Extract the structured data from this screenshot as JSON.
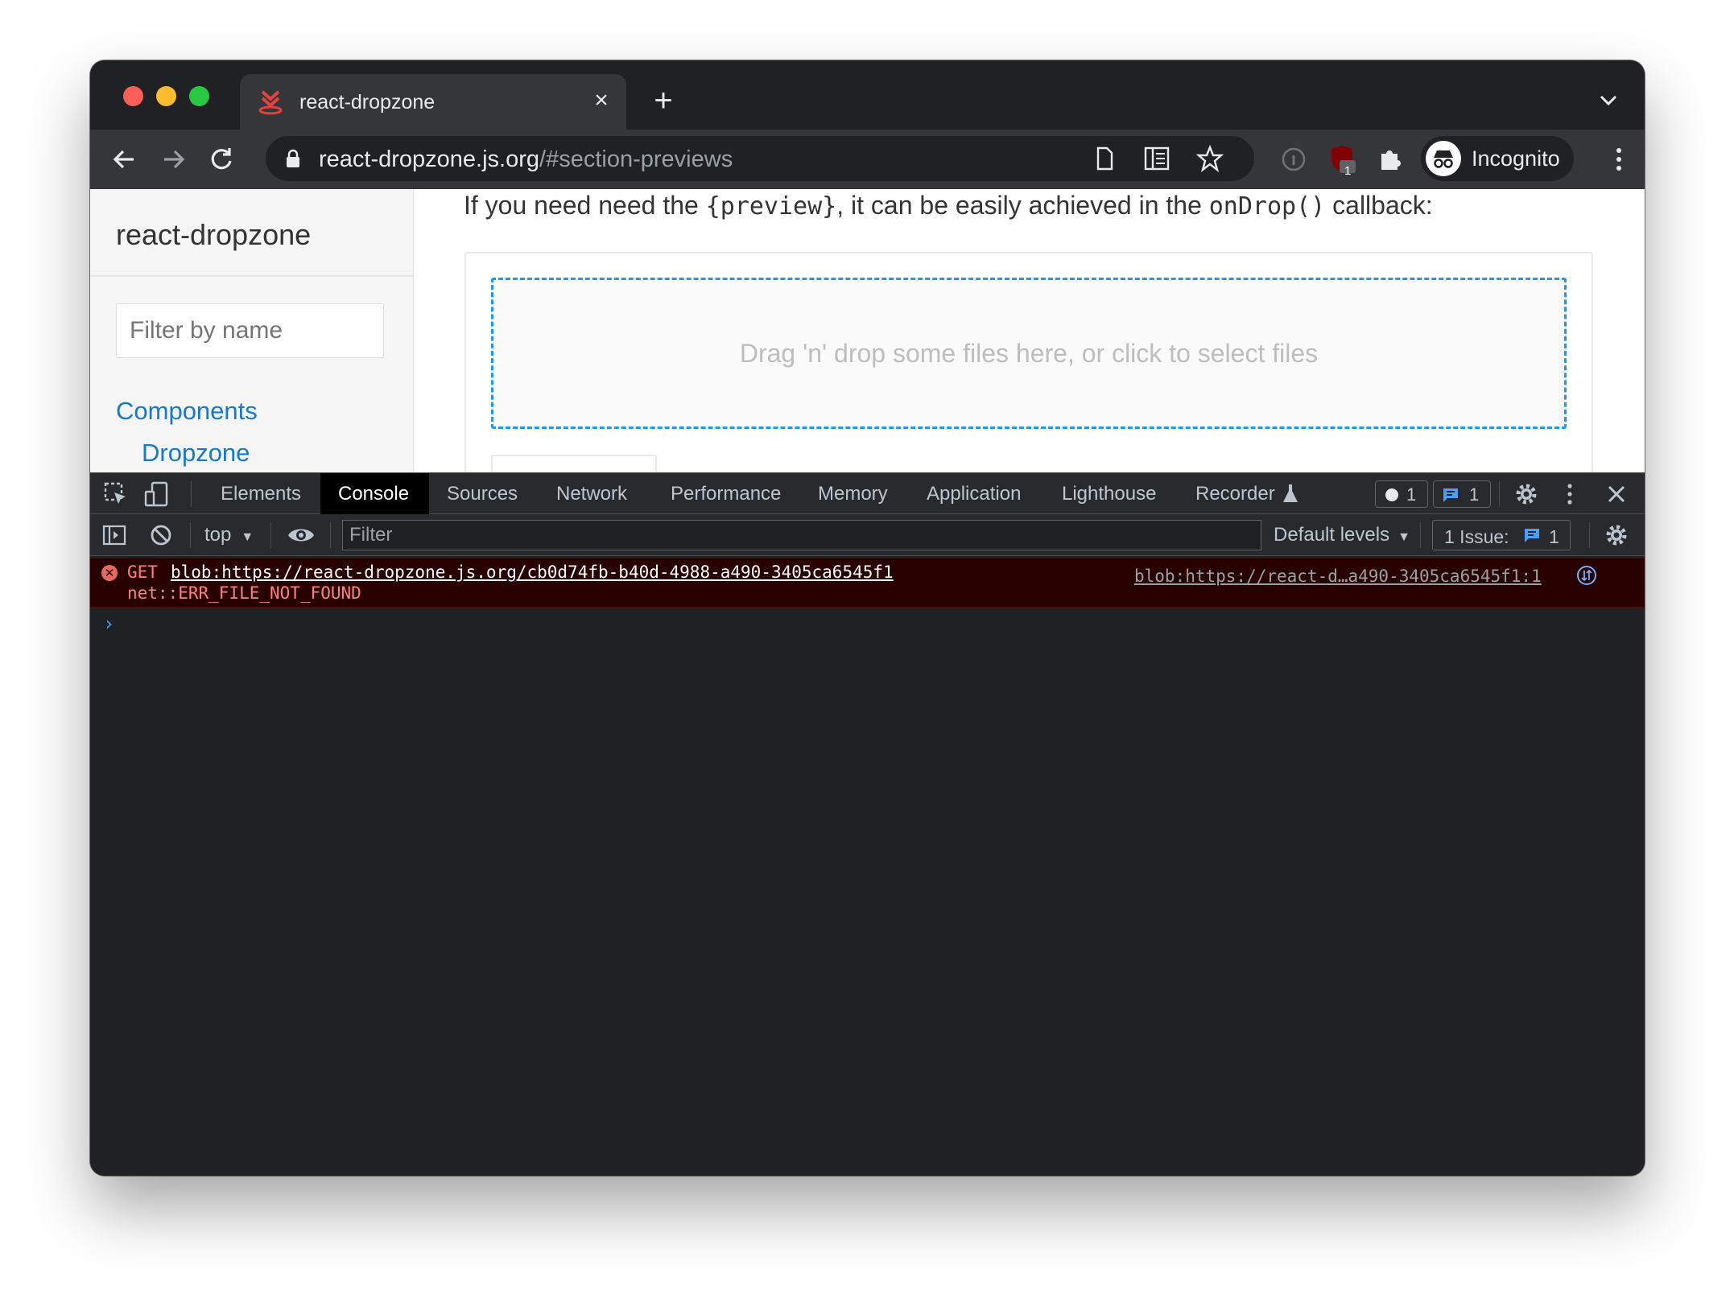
{
  "browser": {
    "tab": {
      "title": "react-dropzone"
    },
    "omnibox": {
      "url_host": "react-dropzone.js.org",
      "url_path": "/#section-previews"
    },
    "profile_label": "Incognito",
    "ublock_count": "1"
  },
  "page": {
    "sidebar": {
      "title": "react-dropzone",
      "filter_placeholder": "Filter by name",
      "links": [
        "Components",
        "Dropzone"
      ]
    },
    "intro": {
      "part1": "If you need need the ",
      "code1": "{preview}",
      "part2": ", it can be easily achieved in the ",
      "code2": "onDrop()",
      "part3": " callback:"
    },
    "dropzone_text": "Drag 'n' drop some files here, or click to select files"
  },
  "devtools": {
    "tabs": [
      "Elements",
      "Console",
      "Sources",
      "Network",
      "Performance",
      "Memory",
      "Application",
      "Lighthouse",
      "Recorder"
    ],
    "active_tab": "Console",
    "error_count": "1",
    "message_count": "1",
    "context": "top",
    "filter_placeholder": "Filter",
    "levels": "Default levels",
    "issues_label": "1 Issue:",
    "issues_count": "1",
    "messages": [
      {
        "level": "error",
        "method": "GET",
        "url": "blob:https://react-dropzone.js.org/cb0d74fb-b40d-4988-a490-3405ca6545f1",
        "detail": "net::ERR_FILE_NOT_FOUND",
        "source": "blob:https://react-d…a490-3405ca6545f1:1"
      }
    ],
    "prompt": "›"
  },
  "colors": {
    "accent_blue": "#2196f3",
    "link_blue": "#1978c8",
    "error_red": "#e46962",
    "devtools_bg": "#202124"
  }
}
